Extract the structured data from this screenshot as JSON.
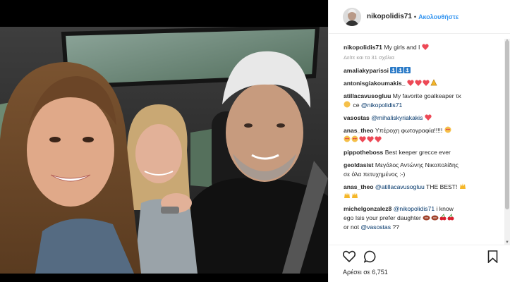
{
  "post": {
    "username": "nikopolidis71",
    "dot": "•",
    "follow_label": "Ακολουθήστε",
    "caption_user": "nikopolidis71",
    "caption_text": "My girls and I",
    "timestamp": "Δείτε και τα 31 σχόλια",
    "likes_label": "Αρέσει σε 6,751"
  },
  "comments": [
    {
      "user": "amaliakyparissi",
      "text": "",
      "emoji": [
        "anchor",
        "anchor",
        "anchor"
      ]
    },
    {
      "user": "antonisgiakoumakis_",
      "text": "",
      "emoji": [
        "heart",
        "heart",
        "heart",
        "hands"
      ]
    },
    {
      "user": "atillacavusogluu",
      "text": "My favorite goalkeaper τκ",
      "emoji_inline": [
        "muscle"
      ],
      "text2": "ce",
      "mention": "@nikopolidis71"
    },
    {
      "user": "vasostas",
      "mention": "@mihaliskyriakakis",
      "emoji": [
        "heart"
      ]
    },
    {
      "user": "anas_theo",
      "text": "Υπέροχη φωτογραφία!!!!!",
      "emoji": [
        "heart-eyes"
      ],
      "emoji2": [
        "heart-eyes",
        "heart-eyes",
        "heart-sm",
        "heart-sm",
        "heart-sm"
      ]
    },
    {
      "user": "pippotheboss",
      "text": "Best keeper grecce ever"
    },
    {
      "user": "geoldasist",
      "text": "Μεγάλος Αντώνης Νικοπολίδης",
      "text2": "σε όλα πετυχημένος :-)"
    },
    {
      "user": "anas_theo",
      "mention": "@atillacavusogluu",
      "text": "THE BEST!",
      "emoji": [
        "hands"
      ],
      "emoji2": [
        "hands",
        "hands"
      ]
    },
    {
      "user": "michelgonzalez8",
      "mention": "@nikopolidis71",
      "text": "i know",
      "text2": "ego Isis your prefer daughter",
      "emoji2": [
        "football",
        "football",
        "cherries",
        "cherries"
      ],
      "text3": "or not",
      "mention3": "@vasostas",
      "text3b": "??"
    }
  ],
  "colors": {
    "accent": "#3897f0",
    "mention": "#003569",
    "heart": "#ed4956",
    "muted": "#999999"
  },
  "icons": [
    "heart-outline-icon",
    "comment-icon",
    "bookmark-icon"
  ]
}
